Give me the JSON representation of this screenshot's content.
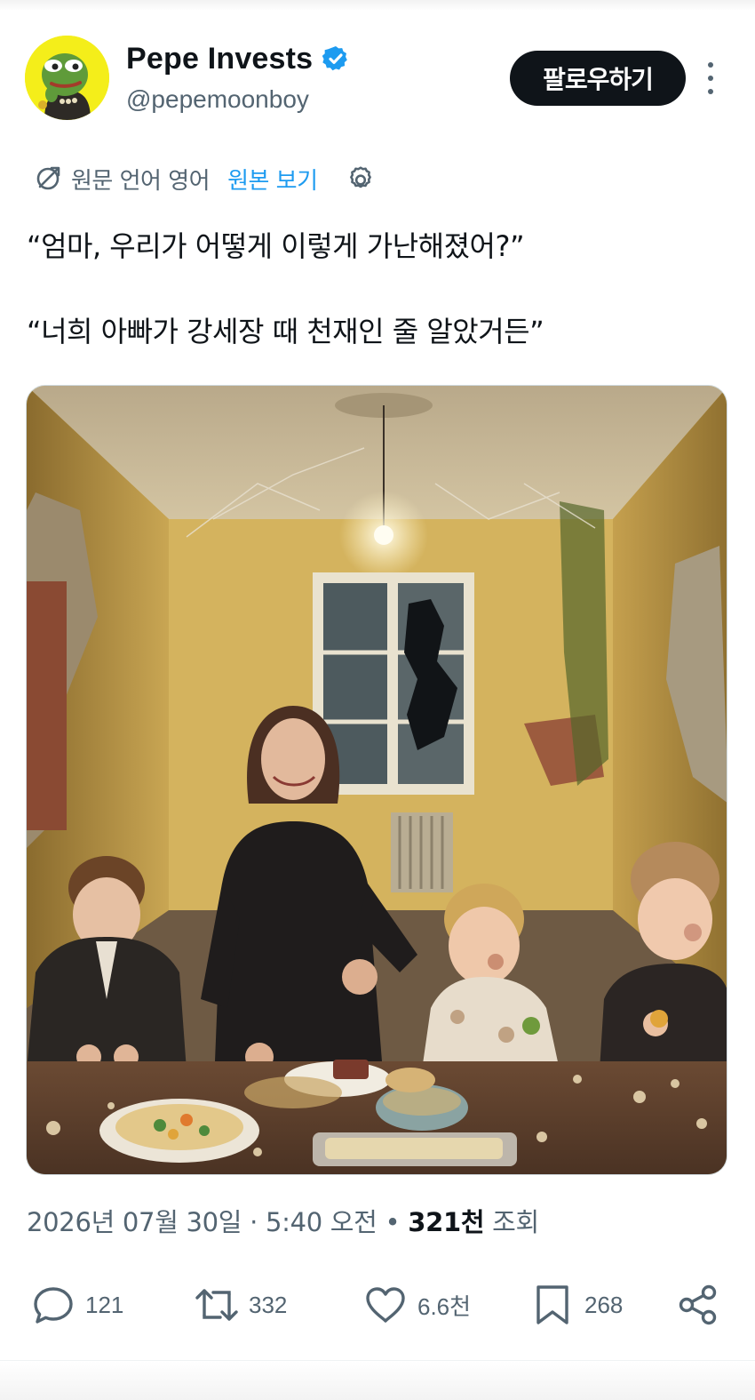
{
  "header": {
    "display_name": "Pepe Invests",
    "handle": "@pepemoonboy",
    "follow_label": "팔로우하기",
    "avatar_icon": "pepe-frog-avatar",
    "verified_icon": "verified-badge-icon",
    "verified_color": "#1d9bf0"
  },
  "translation": {
    "label": "원문 언어 영어",
    "show_original": "원본 보기",
    "link_color": "#1d9bf0"
  },
  "tweet": {
    "lines": [
      "“엄마, 우리가 어떻게 이렇게 가난해졌어?”",
      "“너희 아빠가 강세장 때 천재인 줄 알았거든”"
    ]
  },
  "meta": {
    "date": "2026년 07월 30일",
    "separator": " · ",
    "time": "5:40 오전",
    "dot": " • ",
    "views_count": "321천",
    "views_label": " 조회"
  },
  "actions": {
    "replies": "121",
    "retweets": "332",
    "likes": "6.6천",
    "bookmarks": "268"
  },
  "colors": {
    "text_primary": "#0f1419",
    "text_secondary": "#536471",
    "accent": "#1d9bf0"
  }
}
